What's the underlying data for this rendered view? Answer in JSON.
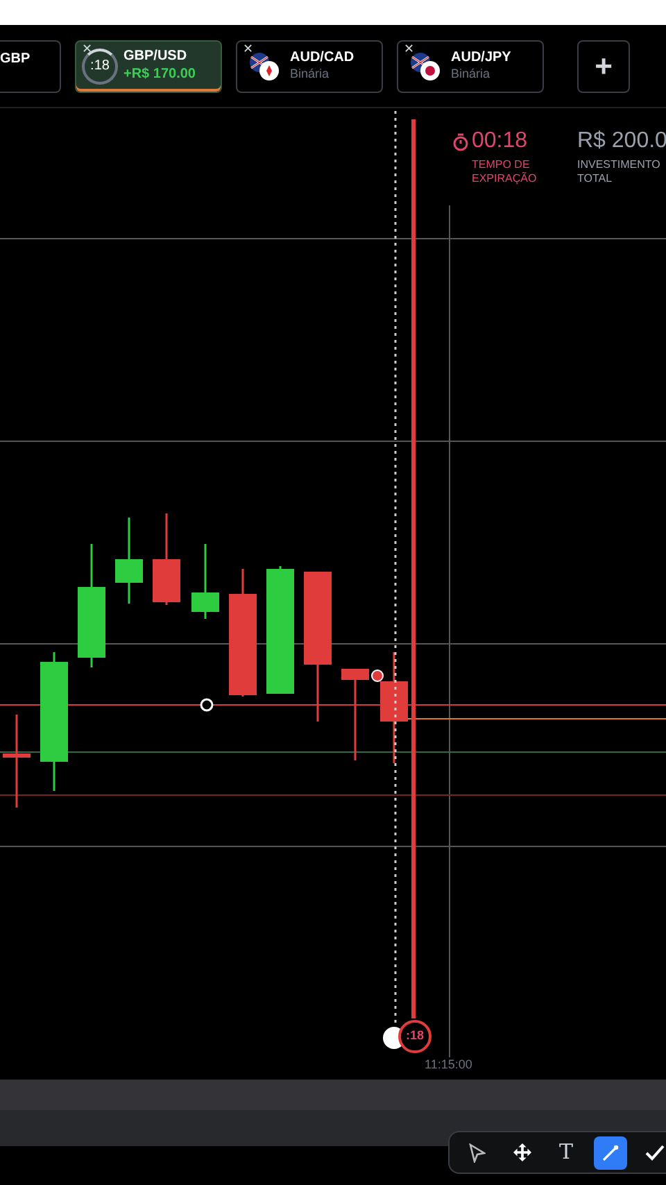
{
  "tabs": [
    {
      "kind": "partial",
      "pair": "GBP",
      "selected": false
    },
    {
      "kind": "active",
      "close": "✕",
      "pair": "GBP/USD",
      "timer": ":18",
      "profit": "+R$ 170.00",
      "selected": true
    },
    {
      "kind": "asset",
      "close": "✕",
      "pair": "AUD/CAD",
      "subtitle": "Binária",
      "flag": {
        "kind": "canada"
      },
      "selected": false
    },
    {
      "kind": "asset",
      "close": "✕",
      "pair": "AUD/JPY",
      "subtitle": "Binária",
      "flag": {
        "kind": "japan"
      },
      "selected": false
    },
    {
      "kind": "add",
      "label": "+",
      "selected": false
    }
  ],
  "expiry": {
    "timer": "00:18",
    "label": "TEMPO DE EXPIRAÇÃO"
  },
  "investment": {
    "value": "R$ 200.0",
    "label": "INVESTIMENTO TOTAL"
  },
  "chart": {
    "expiry_badge": ":18",
    "time_label": "11:15:00"
  },
  "tools": [
    {
      "kind": "pointer",
      "selected": false
    },
    {
      "kind": "move",
      "selected": false
    },
    {
      "kind": "text",
      "label": "T",
      "selected": false
    },
    {
      "kind": "line",
      "selected": true
    },
    {
      "kind": "confirm",
      "selected": false
    }
  ]
}
